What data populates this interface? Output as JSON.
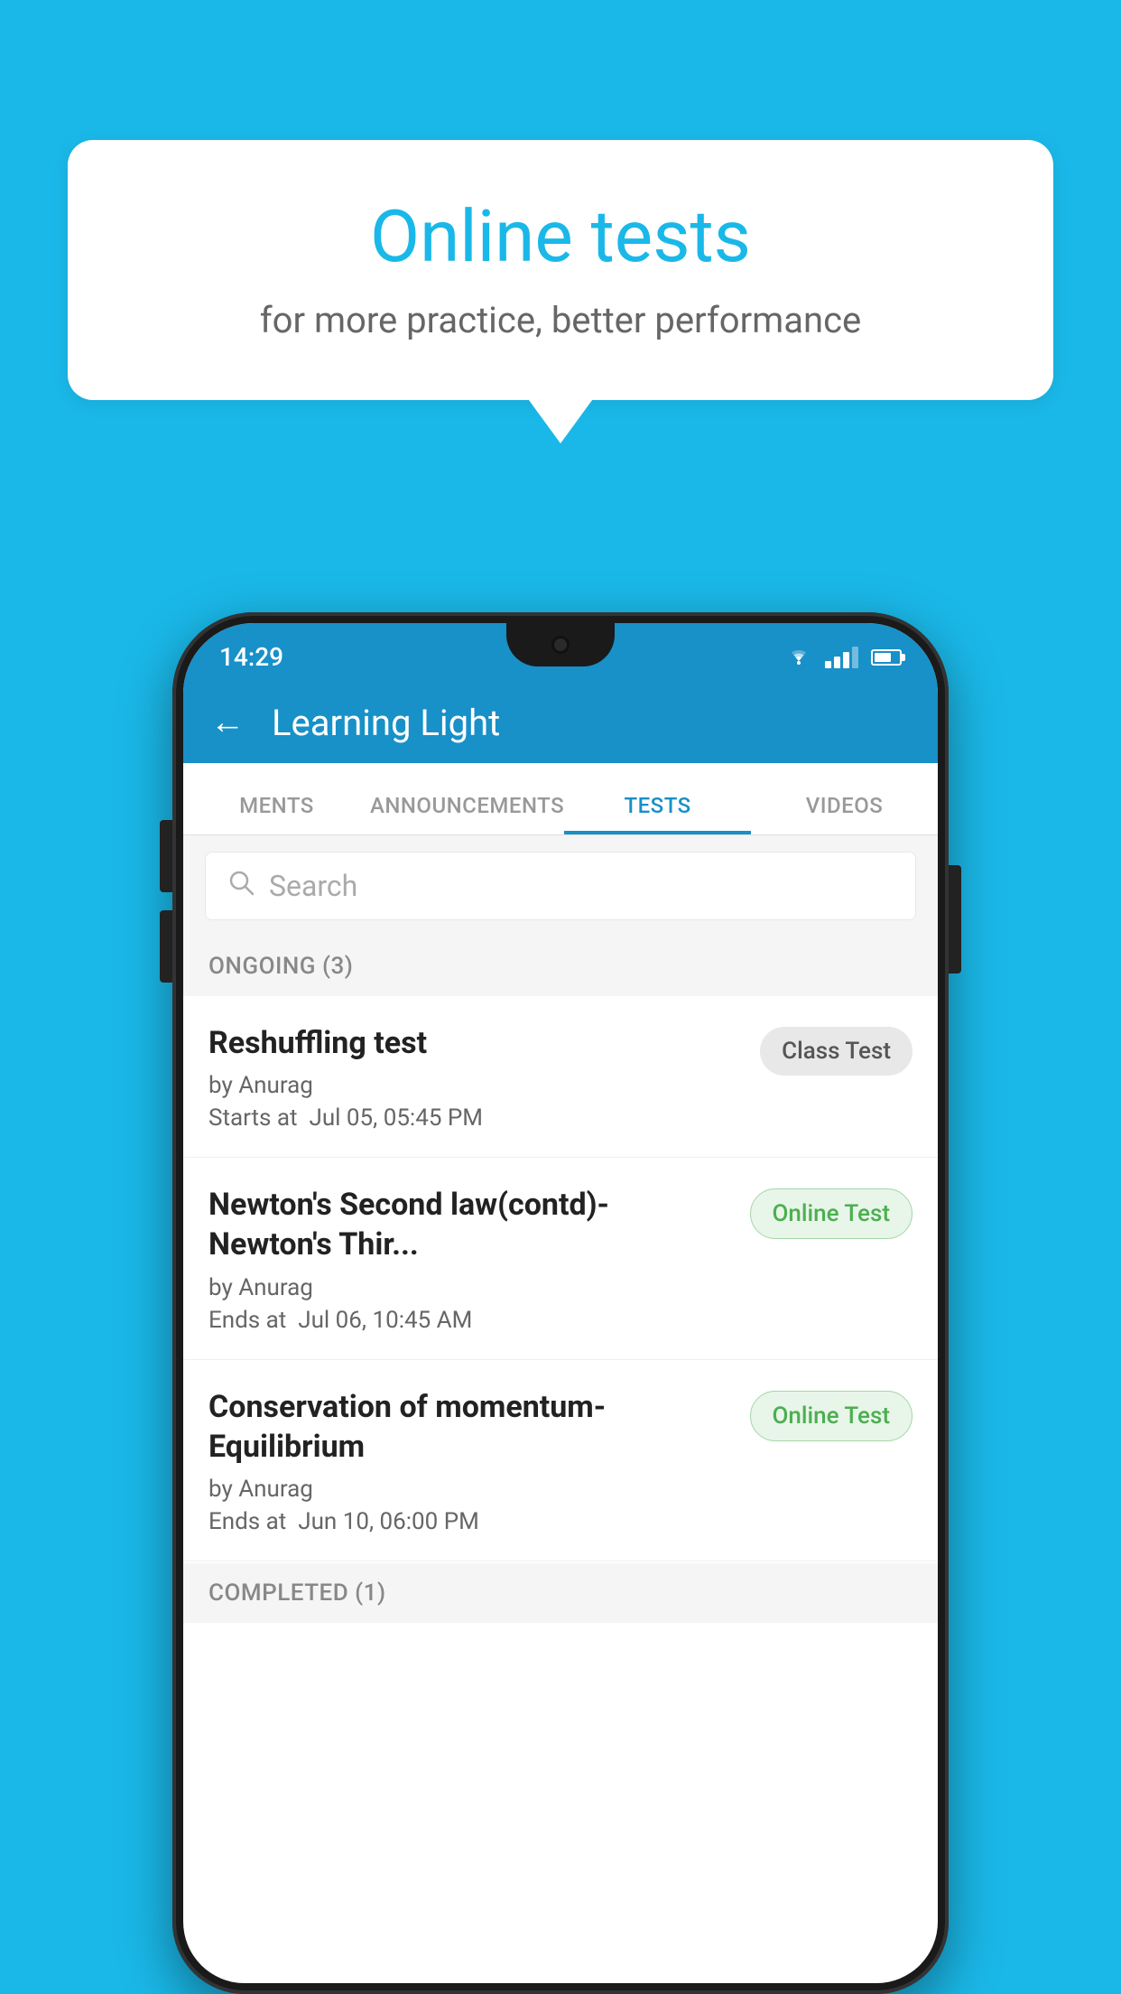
{
  "background": {
    "color": "#1ab8e8"
  },
  "speech_bubble": {
    "title": "Online tests",
    "subtitle": "for more practice, better performance"
  },
  "phone": {
    "status_bar": {
      "time": "14:29"
    },
    "header": {
      "title": "Learning Light",
      "back_label": "←"
    },
    "tabs": [
      {
        "label": "MENTS",
        "active": false
      },
      {
        "label": "ANNOUNCEMENTS",
        "active": false
      },
      {
        "label": "TESTS",
        "active": true
      },
      {
        "label": "VIDEOS",
        "active": false
      }
    ],
    "search": {
      "placeholder": "Search"
    },
    "ongoing_section": {
      "label": "ONGOING (3)"
    },
    "tests": [
      {
        "name": "Reshuffling test",
        "author": "by Anurag",
        "time_label": "Starts at",
        "time": "Jul 05, 05:45 PM",
        "badge": "Class Test",
        "badge_type": "class"
      },
      {
        "name": "Newton's Second law(contd)-Newton's Thir...",
        "author": "by Anurag",
        "time_label": "Ends at",
        "time": "Jul 06, 10:45 AM",
        "badge": "Online Test",
        "badge_type": "online"
      },
      {
        "name": "Conservation of momentum-Equilibrium",
        "author": "by Anurag",
        "time_label": "Ends at",
        "time": "Jun 10, 06:00 PM",
        "badge": "Online Test",
        "badge_type": "online"
      }
    ],
    "completed_section": {
      "label": "COMPLETED (1)"
    }
  }
}
